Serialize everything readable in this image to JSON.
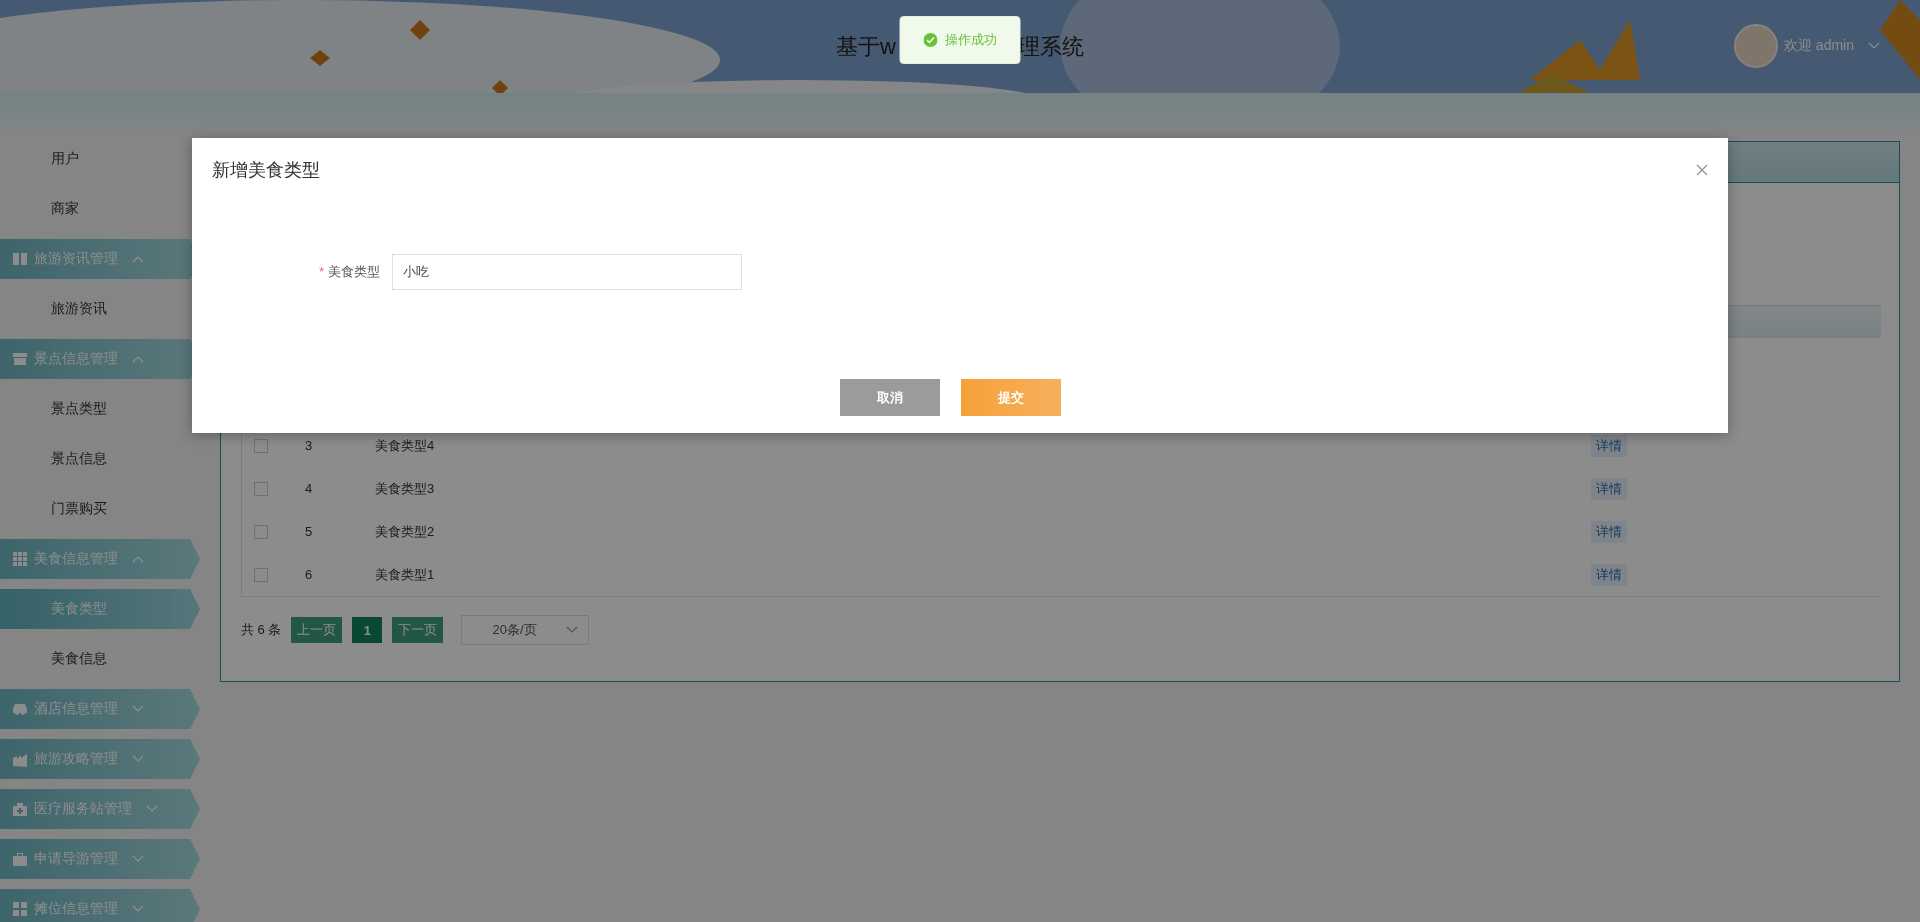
{
  "header": {
    "title_parts": [
      "基于w",
      "理系统"
    ],
    "user": {
      "greeting": "欢迎 admin"
    }
  },
  "toast": {
    "message": "操作成功"
  },
  "sidebar": {
    "items": [
      {
        "kind": "link",
        "label": "用户",
        "selected": false
      },
      {
        "kind": "link",
        "label": "商家",
        "selected": false
      },
      {
        "kind": "group",
        "label": "旅游资讯管理",
        "selected": false,
        "expanded": true,
        "children": [
          {
            "label": "旅游资讯",
            "selected": false
          }
        ]
      },
      {
        "kind": "group",
        "label": "景点信息管理",
        "selected": false,
        "expanded": true,
        "children": [
          {
            "label": "景点类型",
            "selected": false
          },
          {
            "label": "景点信息",
            "selected": false
          },
          {
            "label": "门票购买",
            "selected": false
          }
        ]
      },
      {
        "kind": "group",
        "label": "美食信息管理",
        "selected": false,
        "expanded": true,
        "children": [
          {
            "label": "美食类型",
            "selected": true
          },
          {
            "label": "美食信息",
            "selected": false
          }
        ]
      },
      {
        "kind": "group",
        "label": "酒店信息管理",
        "selected": false,
        "expanded": false
      },
      {
        "kind": "group",
        "label": "旅游攻略管理",
        "selected": false,
        "expanded": false
      },
      {
        "kind": "group",
        "label": "医疗服务站管理",
        "selected": false,
        "expanded": false
      },
      {
        "kind": "group",
        "label": "申请导游管理",
        "selected": false,
        "expanded": false
      },
      {
        "kind": "group",
        "label": "摊位信息管理",
        "selected": false,
        "expanded": false
      }
    ]
  },
  "panel": {
    "table": {
      "rows": [
        {
          "checked": false,
          "index": "3",
          "name": "美食类型4",
          "action": "详情"
        },
        {
          "checked": false,
          "index": "4",
          "name": "美食类型3",
          "action": "详情"
        },
        {
          "checked": false,
          "index": "5",
          "name": "美食类型2",
          "action": "详情"
        },
        {
          "checked": false,
          "index": "6",
          "name": "美食类型1",
          "action": "详情"
        }
      ]
    },
    "pagination": {
      "total": "共 6 条",
      "prev": "上一页",
      "pages": [
        {
          "label": "1",
          "selected": true
        }
      ],
      "next": "下一页",
      "page_size": "20条/页"
    }
  },
  "dialog": {
    "title": "新增美食类型",
    "fields": [
      {
        "label": "美食类型",
        "required_mark": "*",
        "value": "小吃"
      }
    ],
    "buttons": [
      {
        "kind": "cancel",
        "label": "取消"
      },
      {
        "kind": "submit",
        "label": "提交"
      }
    ]
  }
}
